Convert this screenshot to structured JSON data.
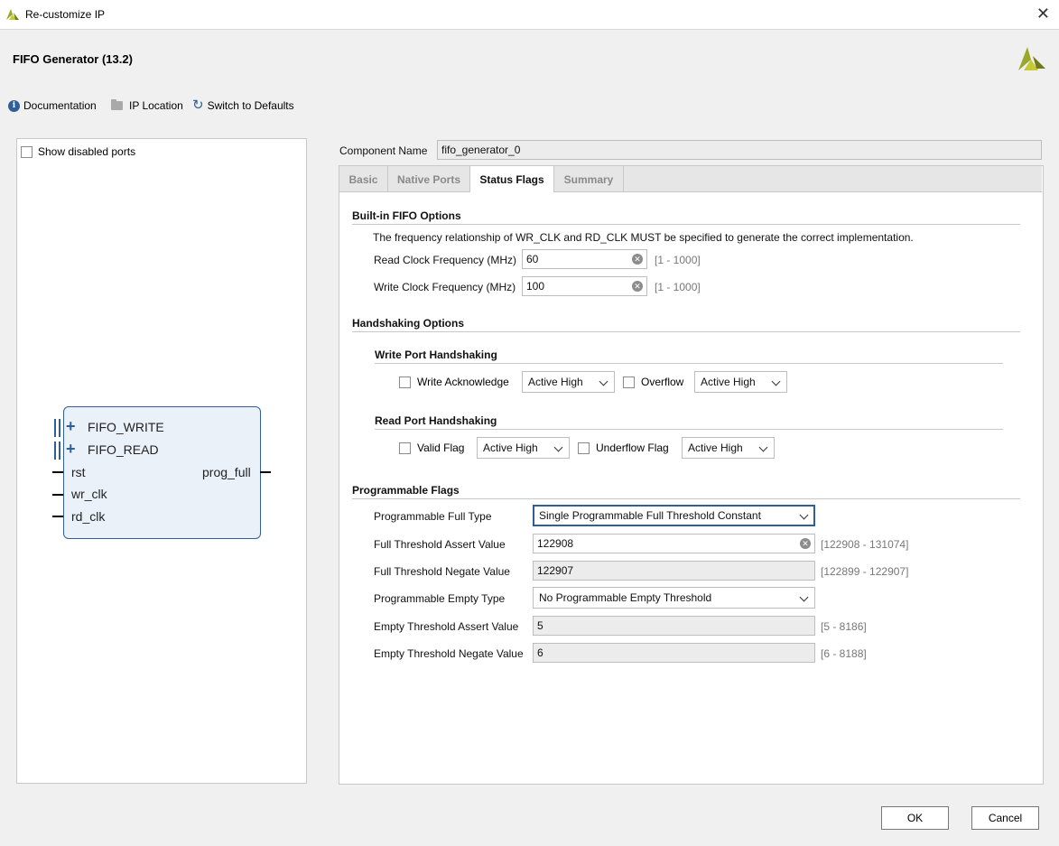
{
  "window": {
    "title": "Re-customize IP",
    "close_label": "✕"
  },
  "header": {
    "name": "FIFO Generator (13.2)"
  },
  "toolbar": {
    "documentation": "Documentation",
    "ip_location": "IP Location",
    "switch_defaults": "Switch to Defaults"
  },
  "left": {
    "show_disabled": "Show disabled ports",
    "ports": {
      "fifo_write": "FIFO_WRITE",
      "fifo_read": "FIFO_READ",
      "rst": "rst",
      "wr_clk": "wr_clk",
      "rd_clk": "rd_clk",
      "prog_full": "prog_full"
    }
  },
  "component": {
    "label": "Component Name",
    "value": "fifo_generator_0"
  },
  "tabs": [
    {
      "label": "Basic"
    },
    {
      "label": "Native Ports"
    },
    {
      "label": "Status Flags"
    },
    {
      "label": "Summary"
    }
  ],
  "builtin": {
    "title": "Built-in FIFO Options",
    "note": "The frequency relationship of WR_CLK and RD_CLK MUST be specified to generate the correct implementation.",
    "read_label": "Read Clock Frequency (MHz)",
    "read_value": "60",
    "read_range": "[1 - 1000]",
    "write_label": "Write Clock Frequency (MHz)",
    "write_value": "100",
    "write_range": "[1 - 1000]"
  },
  "handshaking": {
    "title": "Handshaking Options",
    "write_port": {
      "title": "Write Port Handshaking",
      "ack_label": "Write Acknowledge",
      "ack_select": "Active High",
      "overflow_label": "Overflow",
      "overflow_select": "Active High"
    },
    "read_port": {
      "title": "Read Port Handshaking",
      "valid_label": "Valid Flag",
      "valid_select": "Active High",
      "underflow_label": "Underflow Flag",
      "underflow_select": "Active High"
    }
  },
  "prog": {
    "title": "Programmable Flags",
    "full_type_label": "Programmable Full Type",
    "full_type_value": "Single Programmable Full Threshold Constant",
    "full_assert_label": "Full Threshold Assert Value",
    "full_assert_value": "122908",
    "full_assert_range": "[122908 - 131074]",
    "full_negate_label": "Full Threshold Negate Value",
    "full_negate_value": "122907",
    "full_negate_range": "[122899 - 122907]",
    "empty_type_label": "Programmable Empty Type",
    "empty_type_value": "No Programmable Empty Threshold",
    "empty_assert_label": "Empty Threshold Assert Value",
    "empty_assert_value": "5",
    "empty_assert_range": "[5 - 8186]",
    "empty_negate_label": "Empty Threshold Negate Value",
    "empty_negate_value": "6",
    "empty_negate_range": "[6 - 8188]"
  },
  "buttons": {
    "ok": "OK",
    "cancel": "Cancel"
  },
  "colors": {
    "accent": "#2f5f9b",
    "logo": "#9aa72a"
  }
}
